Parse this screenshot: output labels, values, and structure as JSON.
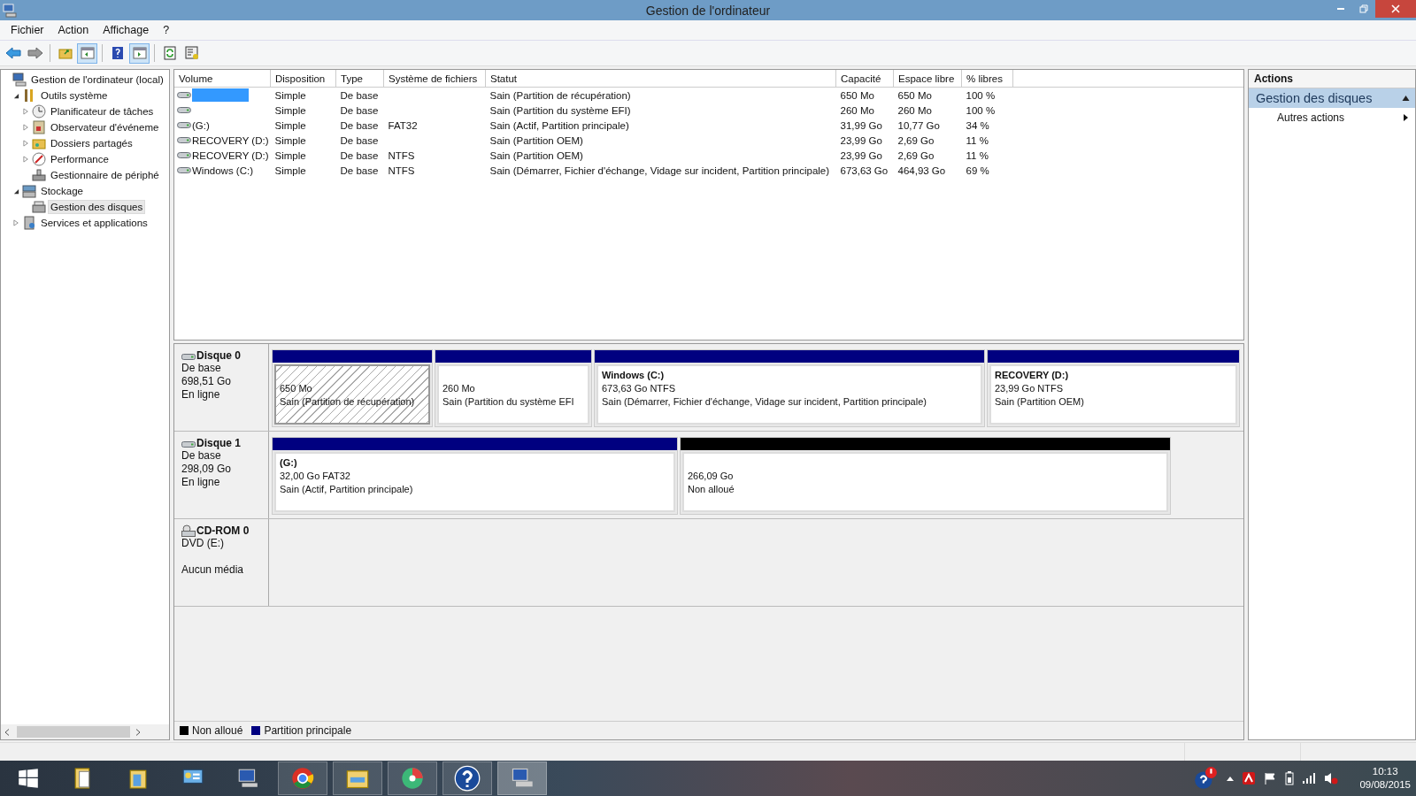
{
  "window": {
    "title": "Gestion de l'ordinateur"
  },
  "menu": [
    "Fichier",
    "Action",
    "Affichage",
    "?"
  ],
  "tree": [
    {
      "label": "Gestion de l'ordinateur (local)",
      "selected": false,
      "children": [
        {
          "label": "Outils système",
          "expanded": true,
          "selected": false,
          "children": [
            {
              "label": "Planificateur de tâches",
              "expanded": false,
              "selected": false
            },
            {
              "label": "Observateur d'événeme",
              "expanded": false,
              "selected": false
            },
            {
              "label": "Dossiers partagés",
              "expanded": false,
              "selected": false
            },
            {
              "label": "Performance",
              "expanded": false,
              "selected": false
            },
            {
              "label": "Gestionnaire de périphé",
              "selected": false
            }
          ]
        },
        {
          "label": "Stockage",
          "expanded": true,
          "selected": false,
          "children": [
            {
              "label": "Gestion des disques",
              "selected": true
            }
          ]
        },
        {
          "label": "Services et applications",
          "expanded": false,
          "selected": false
        }
      ]
    }
  ],
  "volumes": {
    "columns": [
      "Volume",
      "Disposition",
      "Type",
      "Système de fichiers",
      "Statut",
      "Capacité",
      "Espace libre",
      "% libres"
    ],
    "rows": [
      {
        "selected": true,
        "layout": "Simple",
        "type": "De base",
        "status": "Sain (Partition de récupération)",
        "capacity": "650 Mo",
        "free": "650 Mo",
        "pct": "100 %"
      },
      {
        "selected": false,
        "layout": "Simple",
        "type": "De base",
        "status": "Sain (Partition du système EFI)",
        "capacity": "260 Mo",
        "free": "260 Mo",
        "pct": "100 %"
      },
      {
        "selected": false,
        "volume": " (G:)",
        "layout": "Simple",
        "type": "De base",
        "fs": "FAT32",
        "status": "Sain (Actif, Partition principale)",
        "capacity": "31,99 Go",
        "free": "10,77 Go",
        "pct": "34 %"
      },
      {
        "selected": false,
        "volume": "RECOVERY (D:)",
        "layout": "Simple",
        "type": "De base",
        "status": "Sain (Partition OEM)",
        "capacity": "23,99 Go",
        "free": "2,69 Go",
        "pct": "11 %"
      },
      {
        "selected": false,
        "volume": "RECOVERY (D:)",
        "layout": "Simple",
        "type": "De base",
        "fs": "NTFS",
        "status": "Sain (Partition OEM)",
        "capacity": "23,99 Go",
        "free": "2,69 Go",
        "pct": "11 %"
      },
      {
        "selected": false,
        "volume": "Windows (C:)",
        "layout": "Simple",
        "type": "De base",
        "fs": "NTFS",
        "status": "Sain (Démarrer, Fichier d'échange, Vidage sur incident, Partition principale)",
        "capacity": "673,63 Go",
        "free": "464,93 Go",
        "pct": "69 %"
      }
    ]
  },
  "disks": [
    {
      "name": "Disque 0",
      "kind": "disk",
      "type": "De base",
      "size": "698,51 Go",
      "status": "En ligne",
      "partitions": [
        {
          "kind": "primary",
          "selected": true,
          "size": "650 Mo",
          "status": "Sain (Partition de récupération)"
        },
        {
          "kind": "primary",
          "selected": false,
          "size": "260 Mo",
          "status": "Sain (Partition du système EFI"
        },
        {
          "kind": "primary",
          "selected": false,
          "title": "Windows  (C:)",
          "size": "673,63 Go NTFS",
          "status": "Sain (Démarrer, Fichier d'échange, Vidage sur incident, Partition principale)"
        },
        {
          "kind": "primary",
          "selected": false,
          "title": "RECOVERY  (D:)",
          "size": "23,99 Go NTFS",
          "status": "Sain (Partition OEM)"
        }
      ]
    },
    {
      "name": "Disque 1",
      "kind": "disk",
      "type": "De base",
      "size": "298,09 Go",
      "status": "En ligne",
      "partitions": [
        {
          "kind": "primary",
          "selected": false,
          "title": "(G:)",
          "size": "32,00 Go FAT32",
          "status": "Sain (Actif, Partition principale)"
        },
        {
          "kind": "unallocated",
          "selected": false,
          "size": "266,09 Go",
          "status": "Non alloué"
        }
      ]
    },
    {
      "name": "CD-ROM 0",
      "kind": "cdrom",
      "type": "DVD (E:)",
      "status": "Aucun média"
    }
  ],
  "legend": [
    {
      "label": "Non alloué",
      "color": "#000000"
    },
    {
      "label": "Partition principale",
      "color": "#000080"
    }
  ],
  "actions": {
    "title": "Actions",
    "section": "Gestion des disques",
    "expanded": true,
    "items": [
      "Autres actions"
    ]
  },
  "clock": {
    "time": "10:13",
    "date": "09/08/2015"
  }
}
